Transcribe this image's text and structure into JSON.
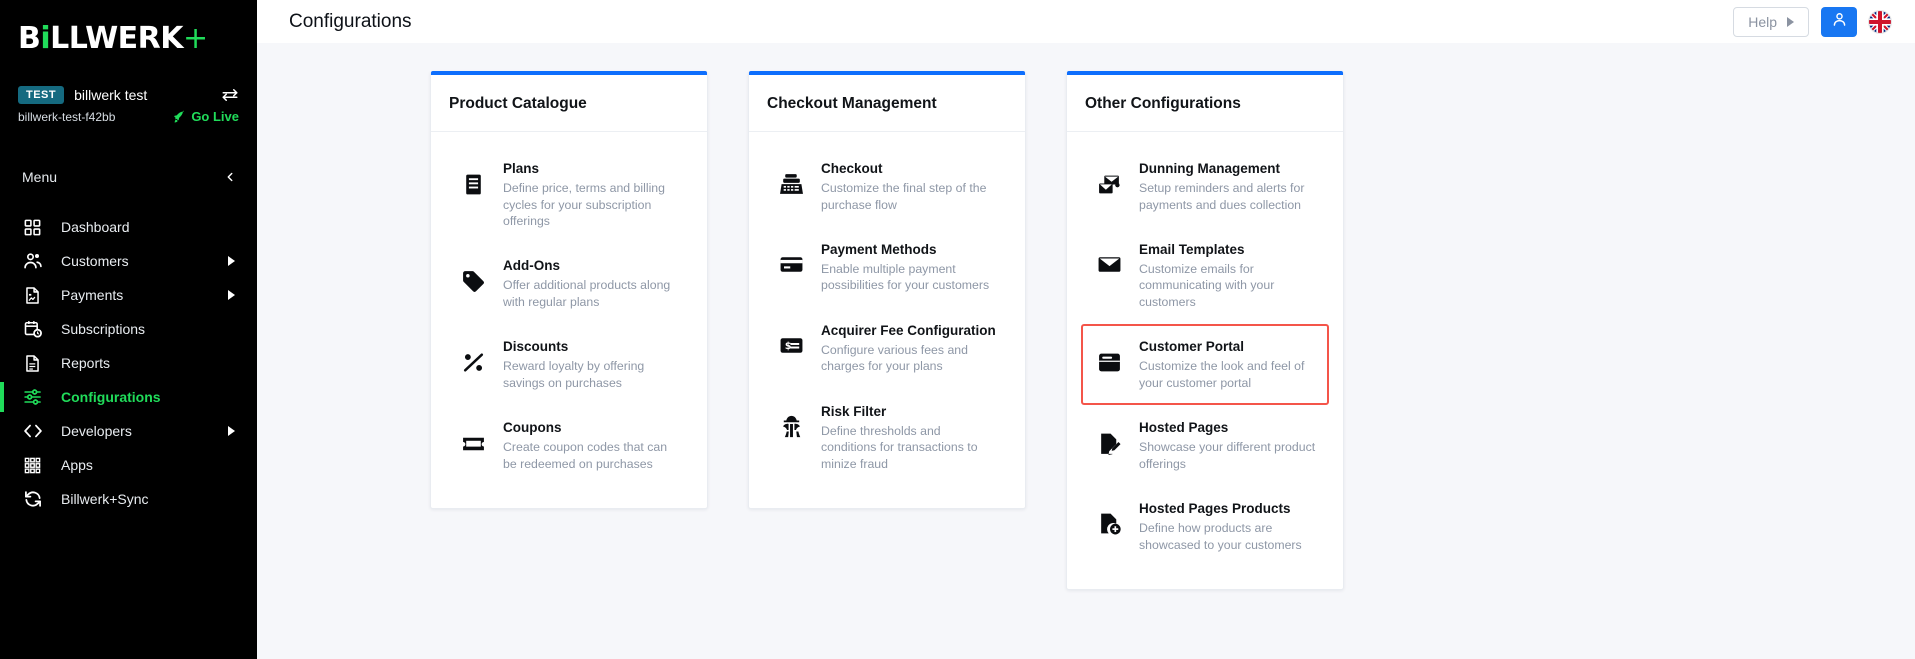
{
  "sidebar": {
    "logo": {
      "pre": "B",
      "accent": "i",
      "mid": "LLWERK",
      "plus": "+"
    },
    "tenant": {
      "badge": "TEST",
      "name": "billwerk test",
      "id": "billwerk-test-f42bb",
      "go_live": "Go Live"
    },
    "menu_label": "Menu",
    "items": [
      {
        "label": "Dashboard",
        "icon": "grid-icon",
        "active": false,
        "caret": false
      },
      {
        "label": "Customers",
        "icon": "users-icon",
        "active": false,
        "caret": true
      },
      {
        "label": "Payments",
        "icon": "invoice-icon",
        "active": false,
        "caret": true
      },
      {
        "label": "Subscriptions",
        "icon": "calendar-clock-icon",
        "active": false,
        "caret": false
      },
      {
        "label": "Reports",
        "icon": "document-icon",
        "active": false,
        "caret": false
      },
      {
        "label": "Configurations",
        "icon": "sliders-icon",
        "active": true,
        "caret": false
      },
      {
        "label": "Developers",
        "icon": "code-icon",
        "active": false,
        "caret": true
      },
      {
        "label": "Apps",
        "icon": "apps-dots-icon",
        "active": false,
        "caret": false
      },
      {
        "label": "Billwerk+Sync",
        "icon": "sync-icon",
        "active": false,
        "caret": false
      }
    ]
  },
  "topbar": {
    "title": "Configurations",
    "help_label": "Help",
    "user_icon": "user-icon",
    "flag_icon": "uk-flag-icon"
  },
  "colors": {
    "brand_green": "#20DC5A",
    "accent_blue": "#0d6efd",
    "primary_blue": "#1877f2",
    "highlight_red": "#f4554a",
    "sidebar_bg": "#000000",
    "content_bg": "#f6f7fa"
  },
  "cards": [
    {
      "title": "Product Catalogue",
      "entries": [
        {
          "title": "Plans",
          "desc": "Define price, terms and billing cycles for your subscription offerings",
          "icon": "plans-icon",
          "highlight": false
        },
        {
          "title": "Add-Ons",
          "desc": "Offer additional products along with regular plans",
          "icon": "tag-icon",
          "highlight": false
        },
        {
          "title": "Discounts",
          "desc": "Reward loyalty by offering savings on purchases",
          "icon": "percent-icon",
          "highlight": false
        },
        {
          "title": "Coupons",
          "desc": "Create coupon codes that can be redeemed on purchases",
          "icon": "ticket-icon",
          "highlight": false
        }
      ]
    },
    {
      "title": "Checkout Management",
      "entries": [
        {
          "title": "Checkout",
          "desc": "Customize the final step of the purchase flow",
          "icon": "cash-register-icon",
          "highlight": false
        },
        {
          "title": "Payment Methods",
          "desc": "Enable multiple payment possibilities for your customers",
          "icon": "credit-card-icon",
          "highlight": false
        },
        {
          "title": "Acquirer Fee Configuration",
          "desc": "Configure various fees and charges for your plans",
          "icon": "fee-card-icon",
          "highlight": false
        },
        {
          "title": "Risk Filter",
          "desc": "Define thresholds and conditions for transactions to minize fraud",
          "icon": "spy-icon",
          "highlight": false
        }
      ]
    },
    {
      "title": "Other Configurations",
      "entries": [
        {
          "title": "Dunning Management",
          "desc": "Setup reminders and alerts for payments and dues collection",
          "icon": "mail-stack-icon",
          "highlight": false
        },
        {
          "title": "Email Templates",
          "desc": "Customize emails for communicating with your customers",
          "icon": "envelope-icon",
          "highlight": false
        },
        {
          "title": "Customer Portal",
          "desc": "Customize the look and feel of your customer portal",
          "icon": "browser-window-icon",
          "highlight": true
        },
        {
          "title": "Hosted Pages",
          "desc": "Showcase your different product offerings",
          "icon": "page-edit-icon",
          "highlight": false
        },
        {
          "title": "Hosted Pages Products",
          "desc": "Define how products are showcased to your customers",
          "icon": "page-plus-icon",
          "highlight": false
        }
      ]
    }
  ]
}
